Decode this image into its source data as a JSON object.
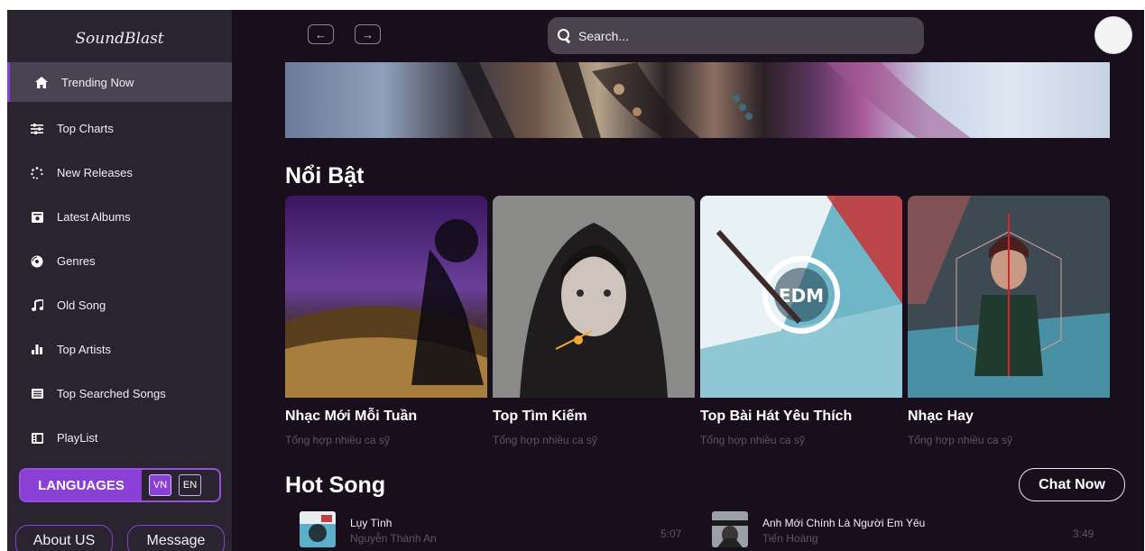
{
  "brand": {
    "name": "SoundBlast"
  },
  "sidebar": {
    "items": [
      {
        "label": "Trending Now",
        "icon": "home-icon"
      },
      {
        "label": "Top Charts",
        "icon": "sliders-icon"
      },
      {
        "label": "New Releases",
        "icon": "spinner-icon"
      },
      {
        "label": "Latest Albums",
        "icon": "album-icon"
      },
      {
        "label": "Genres",
        "icon": "compact-disc-icon"
      },
      {
        "label": "Old Song",
        "icon": "music-note-icon"
      },
      {
        "label": "Top Artists",
        "icon": "bar-chart-icon"
      },
      {
        "label": "Top Searched Songs",
        "icon": "list-box-icon"
      },
      {
        "label": "PlayList",
        "icon": "playlist-icon"
      }
    ],
    "languages": {
      "label": "LANGUAGES",
      "vn": "VN",
      "en": "EN",
      "selected": "VN"
    },
    "about_label": "About US",
    "message_label": "Message"
  },
  "topbar": {
    "back_glyph": "←",
    "forward_glyph": "→",
    "search_placeholder": "Search..."
  },
  "featured": {
    "title": "Nổi Bật",
    "cards": [
      {
        "title": "Nhạc Mới Mỗi Tuần",
        "subtitle": "Tổng hợp nhiều ca sỹ"
      },
      {
        "title": "Top Tìm Kiếm",
        "subtitle": "Tổng hợp nhiều ca sỹ"
      },
      {
        "title": "Top Bài Hát Yêu Thích",
        "subtitle": "Tổng hợp nhiều ca sỹ"
      },
      {
        "title": "Nhạc Hay",
        "subtitle": "Tổng hợp nhiều ca sỹ"
      }
    ]
  },
  "hot_song": {
    "title": "Hot Song",
    "chat_label": "Chat Now",
    "songs": [
      {
        "title": "Lụy Tình",
        "artist": "Nguyễn Thành An",
        "duration": "5:07"
      },
      {
        "title": "Anh Mới Chính Là Người Em Yêu",
        "artist": "Tiến Hoàng",
        "duration": "3:49"
      }
    ]
  },
  "colors": {
    "accent": "#8a3fd6",
    "background": "#190f1c",
    "sidebar": "#2a2430"
  }
}
